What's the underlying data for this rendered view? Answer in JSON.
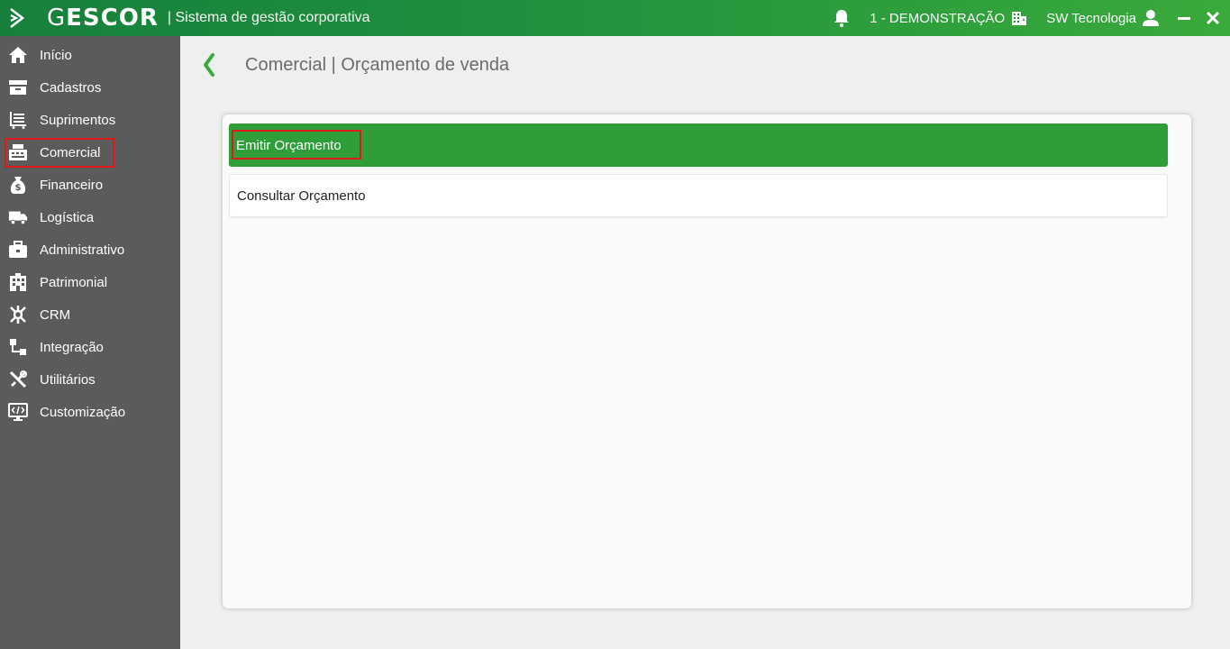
{
  "app": {
    "brand_first": "G",
    "brand_rest": "ESCOR",
    "subtitle": "| Sistema de gestão corporativa",
    "company": "1 - DEMONSTRAÇÃO",
    "user": "SW Tecnologia"
  },
  "colors": {
    "topbar": "#1f8f3e",
    "sidebar": "#5b5b5b",
    "accent": "#2f9e3a",
    "highlight": "#e0181c"
  },
  "sidebar": {
    "items": [
      {
        "label": "Início",
        "icon": "home-icon"
      },
      {
        "label": "Cadastros",
        "icon": "archive-icon"
      },
      {
        "label": "Suprimentos",
        "icon": "cart-list-icon"
      },
      {
        "label": "Comercial",
        "icon": "cash-register-icon"
      },
      {
        "label": "Financeiro",
        "icon": "money-bag-icon"
      },
      {
        "label": "Logística",
        "icon": "truck-icon"
      },
      {
        "label": "Administrativo",
        "icon": "briefcase-icon"
      },
      {
        "label": "Patrimonial",
        "icon": "building-icon"
      },
      {
        "label": "CRM",
        "icon": "network-icon"
      },
      {
        "label": "Integração",
        "icon": "integration-icon"
      },
      {
        "label": "Utilitários",
        "icon": "tools-icon"
      },
      {
        "label": "Customização",
        "icon": "code-monitor-icon"
      }
    ]
  },
  "main": {
    "title": "Comercial | Orçamento de venda",
    "buttons": [
      {
        "label": "Emitir Orçamento"
      },
      {
        "label": "Consultar Orçamento"
      }
    ]
  }
}
